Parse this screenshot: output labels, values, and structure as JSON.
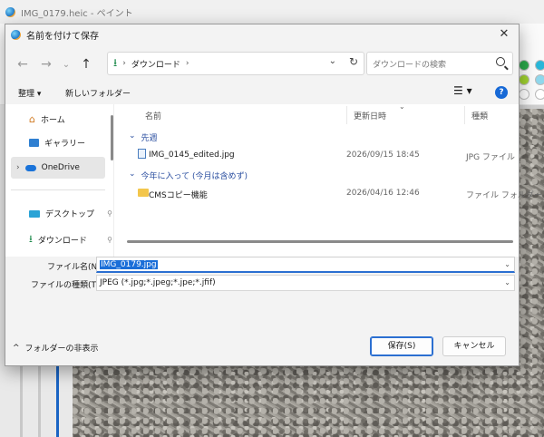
{
  "app": {
    "window_title": "IMG_0179.heic - ペイント"
  },
  "palette": {
    "colors": [
      "#2ba84a",
      "#29b6d8",
      "#9fd12f",
      "#8fd7ec",
      "#ffffff",
      "#ffffff"
    ]
  },
  "dialog": {
    "title": "名前を付けて保存",
    "close_glyph": "✕",
    "nav": {
      "back": "←",
      "forward": "→",
      "recent": "⌄",
      "up": "↑",
      "address_chevron": "›",
      "address_location": "ダウンロード",
      "address_trailing": "›",
      "address_dropdown": "⌄",
      "refresh": "↻",
      "search_placeholder": "ダウンロードの検索"
    },
    "toolbar": {
      "organize": "整理 ▾",
      "new_folder": "新しいフォルダー",
      "view": "☰ ▾",
      "help": "?"
    },
    "sidebar": {
      "items": [
        {
          "label": "ホーム"
        },
        {
          "label": "ギャラリー"
        },
        {
          "label": "OneDrive"
        },
        {
          "label": "デスクトップ"
        },
        {
          "label": "ダウンロード"
        }
      ],
      "expand_glyph": "›",
      "pin_glyph": "📌"
    },
    "file_list": {
      "columns": {
        "name": "名前",
        "date": "更新日時",
        "type": "種類"
      },
      "sort_arrow": "⌄",
      "groups": [
        {
          "header": "先週",
          "rows": [
            {
              "name": "IMG_0145_edited.jpg",
              "date": "2026/09/15 18:45",
              "type": "JPG ファイル"
            }
          ]
        },
        {
          "header": "今年に入って (今月は含めず)",
          "rows": [
            {
              "name": "CMSコピー機能",
              "date": "2026/04/16 12:46",
              "type": "ファイル フォルダー"
            }
          ]
        }
      ],
      "group_chevron": "⌄"
    },
    "form": {
      "filename_label": "ファイル名(N):",
      "filename_value": "IMG_0179.jpg",
      "filetype_label": "ファイルの種類(T):",
      "filetype_value": "JPEG (*.jpg;*.jpeg;*.jpe;*.jfif)",
      "dropdown_glyph": "⌄"
    },
    "footer": {
      "hide_folders": "フォルダーの非表示",
      "hide_folders_glyph": "^",
      "save": "保存(S)",
      "cancel": "キャンセル"
    }
  }
}
